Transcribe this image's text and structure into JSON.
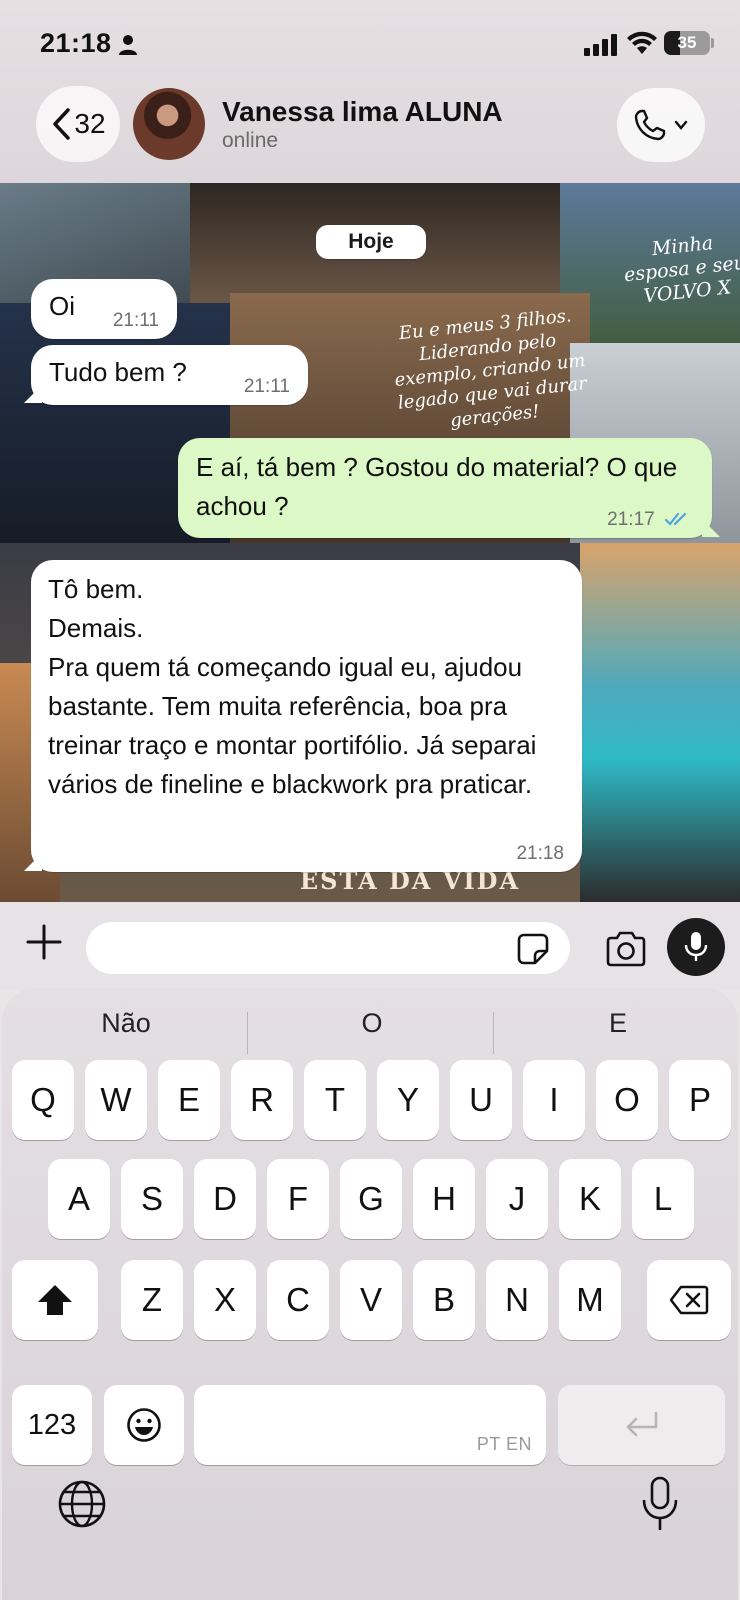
{
  "status_bar": {
    "time": "21:18",
    "battery": "35"
  },
  "header": {
    "back_count": "32",
    "contact_name": "Vanessa lima ALUNA",
    "contact_status": "online"
  },
  "chat": {
    "date_separator": "Hoje",
    "wallpaper_text": {
      "t1": "Eu e meus 3 filhos. Liderando pelo exemplo, criando um legado que vai durar gerações!",
      "t2": "Minha esposa e seu VOLVO X",
      "t3": "ESTA DA VIDA"
    },
    "messages": [
      {
        "direction": "in",
        "text": "Oi",
        "time": "21:11"
      },
      {
        "direction": "in",
        "text": "Tudo bem ?",
        "time": "21:11"
      },
      {
        "direction": "out",
        "text": "E aí, tá bem ? Gostou do material? O que achou ?",
        "time": "21:17",
        "status": "read"
      },
      {
        "direction": "in",
        "lines": [
          "Tô bem.",
          "Demais.",
          "Pra quem tá começando igual eu, ajudou bastante. Tem muita referência, boa pra treinar traço e montar portifólio. Já separai vários de fineline e blackwork pra praticar."
        ],
        "time": "21:18"
      }
    ]
  },
  "composer": {
    "input_value": "",
    "input_placeholder": ""
  },
  "keyboard": {
    "suggestions": [
      "Não",
      "O",
      "E"
    ],
    "row1": [
      "Q",
      "W",
      "E",
      "R",
      "T",
      "Y",
      "U",
      "I",
      "O",
      "P"
    ],
    "row2": [
      "A",
      "S",
      "D",
      "F",
      "G",
      "H",
      "J",
      "K",
      "L"
    ],
    "row3": [
      "Z",
      "X",
      "C",
      "V",
      "B",
      "N",
      "M"
    ],
    "numbers_key": "123",
    "space_language": "PT EN"
  },
  "colors": {
    "outgoing_bubble": "#dcf8c6",
    "read_ticks": "#4fa3e0"
  },
  "icons": {
    "back": "chevron-left-icon",
    "call": "phone-icon",
    "plus": "plus-icon",
    "sticker": "sticker-icon",
    "camera": "camera-icon",
    "mic": "microphone-icon",
    "shift": "shift-icon",
    "delete": "backspace-icon",
    "emoji": "emoji-icon",
    "return": "return-icon",
    "globe": "globe-icon"
  }
}
